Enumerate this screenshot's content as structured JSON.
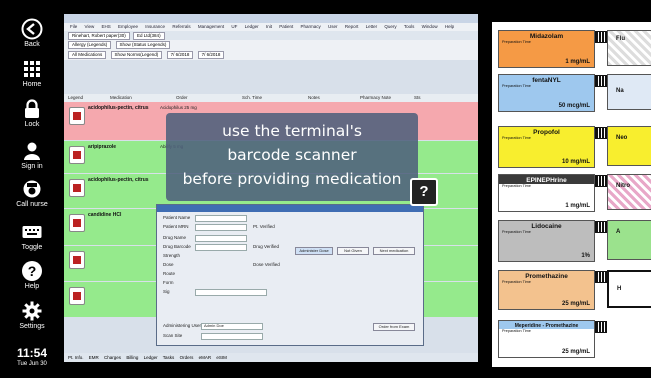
{
  "sidebar": {
    "back": "Back",
    "home": "Home",
    "lock": "Lock",
    "sign_in": "Sign in",
    "call_nurse": "Call nurse",
    "toggle": "Toggle",
    "help": "Help",
    "settings": "Settings"
  },
  "clock": {
    "time": "11:54",
    "date": "Tue Jun 30"
  },
  "ehr": {
    "menu": [
      "File",
      "View",
      "EHS",
      "Employee",
      "Insurance",
      "Referrals",
      "Management",
      "UF",
      "Ledger",
      "Init",
      "Patient",
      "Pharmacy",
      "User",
      "Report",
      "Letter",
      "Query",
      "Tools",
      "Window",
      "Help"
    ],
    "tabs": [
      "Rinehart, Robert paper(30)",
      "Ed Ltd(384)"
    ],
    "toolbar": {
      "med_select": "Allergy (Legends)",
      "status_select": "Show (Status Legends)",
      "medication_filter": "All Medications",
      "dose_filter": "Show Norms(Legend)",
      "date_from": "7/ 6/2018",
      "date_to": "7/ 6/2018"
    },
    "grid_headers": [
      "Legend",
      "Medication",
      "Order",
      "Sch. Time",
      "Notes",
      "Pharmacy Note",
      "Sts"
    ],
    "rows": [
      {
        "medication": "acidophilus-pectin, citrus",
        "order": "Acidophilus 25 mg"
      },
      {
        "medication": "aripiprazole",
        "order": "Abilify 5 mg"
      },
      {
        "medication": "acidophilus-pectin, citrus",
        "order": ""
      },
      {
        "medication": "candidine HCl",
        "order": ""
      }
    ],
    "dialog": {
      "labels": [
        "Patient Name",
        "Patient MRN",
        "Drug Name",
        "Drug Barcode",
        "Strength",
        "Dose",
        "Route",
        "Form",
        "Sig",
        "Administering User",
        "Scan Site"
      ],
      "buttons": [
        "Administer Dose",
        "Not Given",
        "Next medication",
        "Order from Exam"
      ],
      "checks": [
        "Pt. Verified",
        "Drug Verified",
        "Dose Verified"
      ],
      "admin_user": "Admin Doe"
    },
    "bottom_tabs": [
      "Pt. Info.",
      "EMR",
      "Charges",
      "Billing",
      "Ledger",
      "Tasks",
      "Orders",
      "eMAR",
      "eSIM"
    ]
  },
  "overlay": {
    "line1": "use the terminal's",
    "line2": "barcode scanner",
    "line3": "before providing medication"
  },
  "labels": [
    {
      "name": "Midazolam",
      "conc": "1 mg/mL",
      "color": "#f59a45"
    },
    {
      "name": "fentaNYL",
      "conc": "50 mcg/mL",
      "color": "#9ec8ee"
    },
    {
      "name": "Propofol",
      "conc": "10 mg/mL",
      "color": "#f8ee2e"
    },
    {
      "name": "EPINEPHrine",
      "conc": "1 mg/mL",
      "color": "#3a3a3a"
    },
    {
      "name": "Lidocaine",
      "conc": "1%",
      "color": "#bdbdbd"
    },
    {
      "name": "Promethazine",
      "conc": "25 mg/mL",
      "color": "#f3c28e"
    },
    {
      "name": "Meperidine - Promethazine",
      "conc": "25 mg/mL",
      "color": "#9ec8ee"
    }
  ],
  "side_labels": [
    "Flu",
    "Na",
    "Neo",
    "Nitro",
    "A",
    "H"
  ],
  "label_small": "Preparation Time",
  "initials_label": "By:"
}
